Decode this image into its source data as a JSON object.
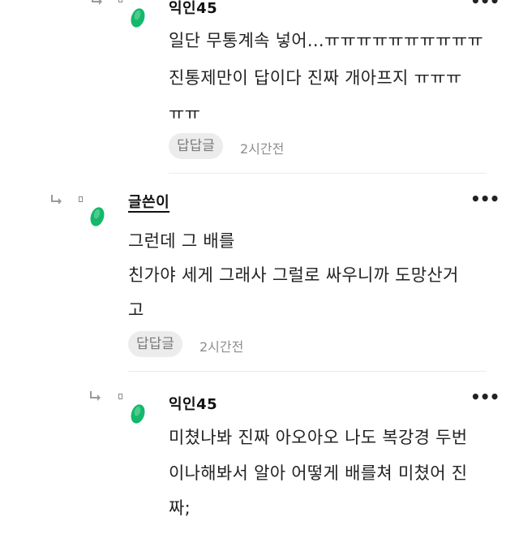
{
  "comments": [
    {
      "author": "익인45",
      "lines": [
        "일단 무통계속 넣어...ㅠㅠㅠㅠㅠㅠㅠㅠㅠㅠ",
        "진통제만이 답이다 진짜 개아프지 ㅠㅠㅠ",
        "ㅠㅠ"
      ],
      "reaction_label": "답답글",
      "time": "2시간전"
    },
    {
      "author": "글쓴이",
      "lines": [
        "그런데 그 배를",
        "친가야 세게 그래사 그럴로 싸우니까 도망산거",
        "고"
      ],
      "reaction_label": "답답글",
      "time": "2시간전"
    },
    {
      "author": "익인45",
      "lines": [
        "미쳤나봐 진짜 아오아오 나도 복강경 두번",
        "이나해봐서 알아 어떻게 배를쳐 미쳤어 진",
        "짜;"
      ]
    }
  ],
  "more_icon_label": "•••",
  "colors": {
    "avatar": "#14b86a",
    "chip_bg": "#ececec",
    "divider": "#ebebeb"
  }
}
